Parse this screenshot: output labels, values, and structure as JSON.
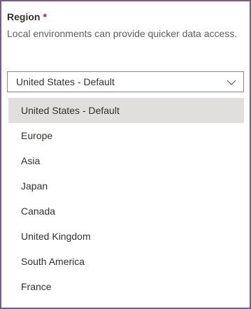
{
  "field": {
    "label": "Region",
    "required_marker": "*",
    "description": "Local environments can provide quicker data access."
  },
  "dropdown": {
    "selected_value": "United States - Default",
    "expanded": true,
    "icon": "chevron-down-icon"
  },
  "options": [
    {
      "label": "United States - Default",
      "selected": true
    },
    {
      "label": "Europe",
      "selected": false
    },
    {
      "label": "Asia",
      "selected": false
    },
    {
      "label": "Japan",
      "selected": false
    },
    {
      "label": "Canada",
      "selected": false
    },
    {
      "label": "United Kingdom",
      "selected": false
    },
    {
      "label": "South America",
      "selected": false
    },
    {
      "label": "France",
      "selected": false
    }
  ],
  "colors": {
    "frame_border": "#7a5a86",
    "required": "#a4262c",
    "selected_bg": "#e1dfdd",
    "input_border": "#8a8886"
  }
}
